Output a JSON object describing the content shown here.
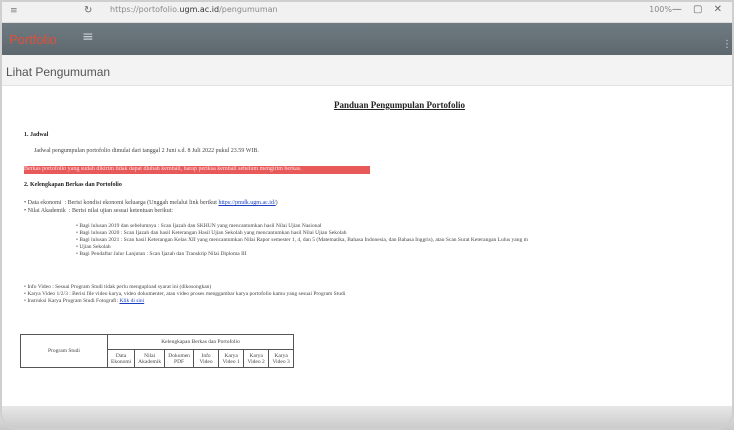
{
  "browser": {
    "tab_icon": "≡",
    "nav_glyph": "↻",
    "url_prefix": "https://portofolio.",
    "url_domain": "ugm.ac.id",
    "url_suffix": "/pengumuman",
    "zoom": "100%",
    "window_controls": "—  ▢  ✕"
  },
  "appbar": {
    "brand": "Portfolio",
    "menu_glyph": "≡",
    "edge_glyph": "⋮"
  },
  "page": {
    "heading": "Lihat Pengumuman"
  },
  "doc": {
    "title": "Panduan Pengumpulan Portofolio",
    "sec1_title": "1. Jadwal",
    "sec1_text": "Jadwal pengumpulan portofolio dimulai dari tanggal 2 Juni s.d. 8 Juli 2022 pukul 23.59 WIB.",
    "sec1_highlight": "Berkas portofolio yang sudah dikirim tidak dapat diubah kembali, harap periksa kembali sebelum mengirim berkas.",
    "sec2_title": "2. Kelengkapan Berkas dan Portofolio",
    "items": [
      {
        "label": "Data ekonomi",
        "text": ": Berisi kondisi ekonomi keluarga (Unggah melalui link berikut"
      },
      {
        "label": "Nilai Akademik",
        "text": ": Berisi nilai ujian sesuai ketentuan berikut:"
      }
    ],
    "link1": "https://pmdk.ugm.ac.id/",
    "sub_items": [
      "Bagi lulusan 2019 dan sebelumnya : Scan Ijazah dan SKHUN yang mencantumkan hasil Nilai Ujian Nasional",
      "Bagi lulusan 2020 : Scan Ijazah dan hasil Keterangan Hasil Ujian Sekolah yang mencantumkan hasil Nilai Ujian Sekolah",
      "Bagi lulusan 2021 : Scan hasil Keterangan Kelas XII yang mencantumkan Nilai Rapor semester 1, 4, dan 5 (Matematika, Bahasa Indonesia, dan Bahasa Inggris), atau Scan Surat Keterangan Lulus yang m",
      "Ujian Sekolah",
      "Bagi Pendaftar Jalur Lanjutan : Scan Ijazah dan Transkrip Nilai Diploma III"
    ],
    "more_items": [
      "Info Video : Sesuai Program Studi tidak perlu mengupload syarat ini (dikosongkan)",
      "Karya Video 1/2/3 : Berisi file video karya, video dokumenter, atau video proses menggambar karya portofolio kamu yang sesuai Program Studi",
      "Instruksi Karya Program Studi Fotografi:"
    ],
    "link2": "Klik di sini"
  },
  "table": {
    "col_program": "Program Studi",
    "group_header": "Kelengkapan Berkas dan Portofolio",
    "cols": [
      "Data Ekonomi",
      "Nilai Akademik",
      "Dokumen PDF",
      "Info Video",
      "Karya Video 1",
      "Karya Video 2",
      "Karya Video 3"
    ]
  }
}
